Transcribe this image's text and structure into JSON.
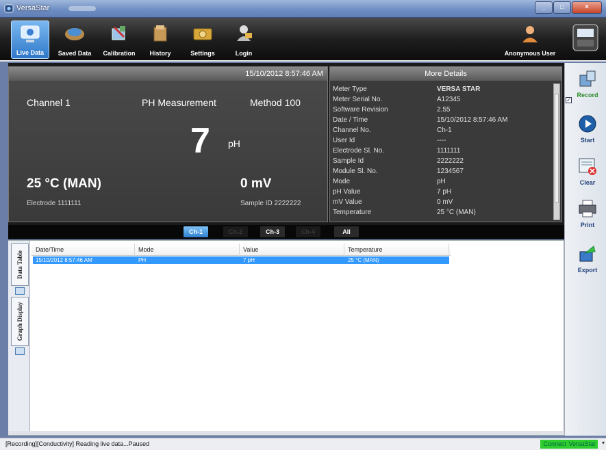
{
  "window": {
    "title": "VersaStar"
  },
  "toolbar": {
    "items": [
      {
        "label": "Live Data",
        "icon": "monitor-icon",
        "active": true
      },
      {
        "label": "Saved Data",
        "icon": "saved-data-icon"
      },
      {
        "label": "Calibration",
        "icon": "calibration-icon"
      },
      {
        "label": "History",
        "icon": "history-icon"
      },
      {
        "label": "Settings",
        "icon": "settings-icon"
      },
      {
        "label": "Login",
        "icon": "login-icon"
      }
    ],
    "user": "Anonymous User"
  },
  "live": {
    "datetime": "15/10/2012 8:57:46 AM",
    "channel": "Channel 1",
    "measurement": "PH Measurement",
    "method": "Method 100",
    "value": "7",
    "unit": "pH",
    "temperature": "25 °C (MAN)",
    "mv": "0 mV",
    "electrode": "Electrode 1111111",
    "sample": "Sample ID 2222222"
  },
  "details": {
    "title": "More Details",
    "rows": [
      {
        "k": "Meter Type",
        "v": "VERSA STAR",
        "strong": true
      },
      {
        "k": "Meter Serial No.",
        "v": "A12345"
      },
      {
        "k": "Software Revision",
        "v": "2.55"
      },
      {
        "k": "Date / Time",
        "v": "15/10/2012 8:57:46 AM"
      },
      {
        "k": "Channel No.",
        "v": "Ch-1"
      },
      {
        "k": "User Id",
        "v": "----"
      },
      {
        "k": "Electrode Sl. No.",
        "v": "1111111"
      },
      {
        "k": "Sample Id",
        "v": "2222222"
      },
      {
        "k": "Module Sl. No.",
        "v": "1234567"
      },
      {
        "k": "Mode",
        "v": "pH"
      },
      {
        "k": "pH Value",
        "v": "7 pH"
      },
      {
        "k": "mV Value",
        "v": "0 mV"
      },
      {
        "k": "Temperature",
        "v": "25 °C (MAN)"
      }
    ]
  },
  "channels": [
    {
      "label": "Ch-1",
      "state": "active"
    },
    {
      "label": "Ch-2",
      "state": "disabled"
    },
    {
      "label": "Ch-3",
      "state": "normal"
    },
    {
      "label": "Ch-4",
      "state": "disabled"
    },
    {
      "label": "All",
      "state": "normal"
    }
  ],
  "vtabs": {
    "data_table": "Data Table",
    "graph_display": "Graph Display"
  },
  "grid": {
    "columns": [
      "Date/Time",
      "Mode",
      "Value",
      "Temperature"
    ],
    "rows": [
      [
        "15/10/2012 8:57:46 AM",
        "PH",
        "7 pH",
        "25 °C (MAN)"
      ]
    ]
  },
  "sidebar": {
    "checkbox": "✓",
    "items": [
      {
        "label": "Record",
        "icon": "record-icon"
      },
      {
        "label": "Start",
        "icon": "start-icon"
      },
      {
        "label": "Clear",
        "icon": "clear-icon"
      },
      {
        "label": "Print",
        "icon": "print-icon"
      },
      {
        "label": "Export",
        "icon": "export-icon"
      }
    ]
  },
  "status": {
    "message": "[Recording][Conductivity] Reading live data...Paused",
    "connection": "Connected to",
    "device": "VersaStar",
    "dropdown": "▾"
  }
}
